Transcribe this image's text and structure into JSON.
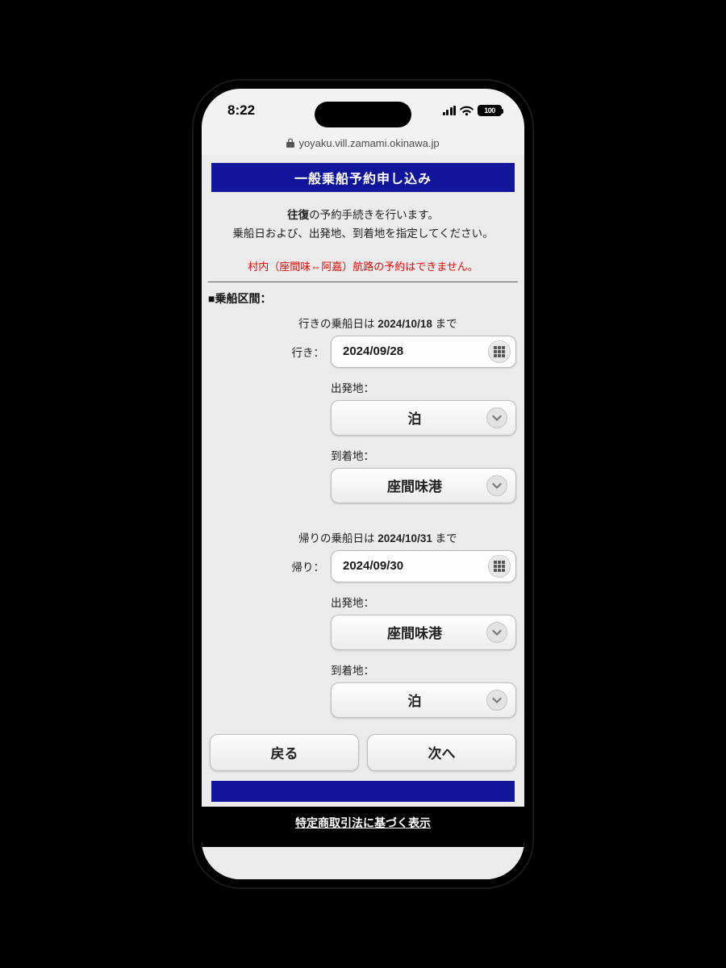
{
  "status": {
    "time": "8:22",
    "battery": "100"
  },
  "url": "yoyaku.vill.zamami.okinawa.jp",
  "banner": "一般乗船予約申し込み",
  "intro_bold": "往復",
  "intro_line1_rest": "の予約手続きを行います。",
  "intro_line2": "乗船日および、出発地、到着地を指定してください。",
  "warning": "村内（座間味⇔阿嘉）航路の予約はできません。",
  "section_label": "■乗船区間：",
  "outbound": {
    "note_prefix": "行きの乗船日は ",
    "note_date": "2024/10/18",
    "note_suffix": " まで",
    "label": "行き：",
    "date": "2024/09/28",
    "dep_label": "出発地：",
    "dep_value": "泊",
    "arr_label": "到着地：",
    "arr_value": "座間味港"
  },
  "return": {
    "note_prefix": "帰りの乗船日は ",
    "note_date": "2024/10/31",
    "note_suffix": " まで",
    "label": "帰り：",
    "date": "2024/09/30",
    "dep_label": "出発地：",
    "dep_value": "座間味港",
    "arr_label": "到着地：",
    "arr_value": "泊"
  },
  "back_button": "戻る",
  "next_button": "次へ",
  "legal": "特定商取引法に基づく表示"
}
